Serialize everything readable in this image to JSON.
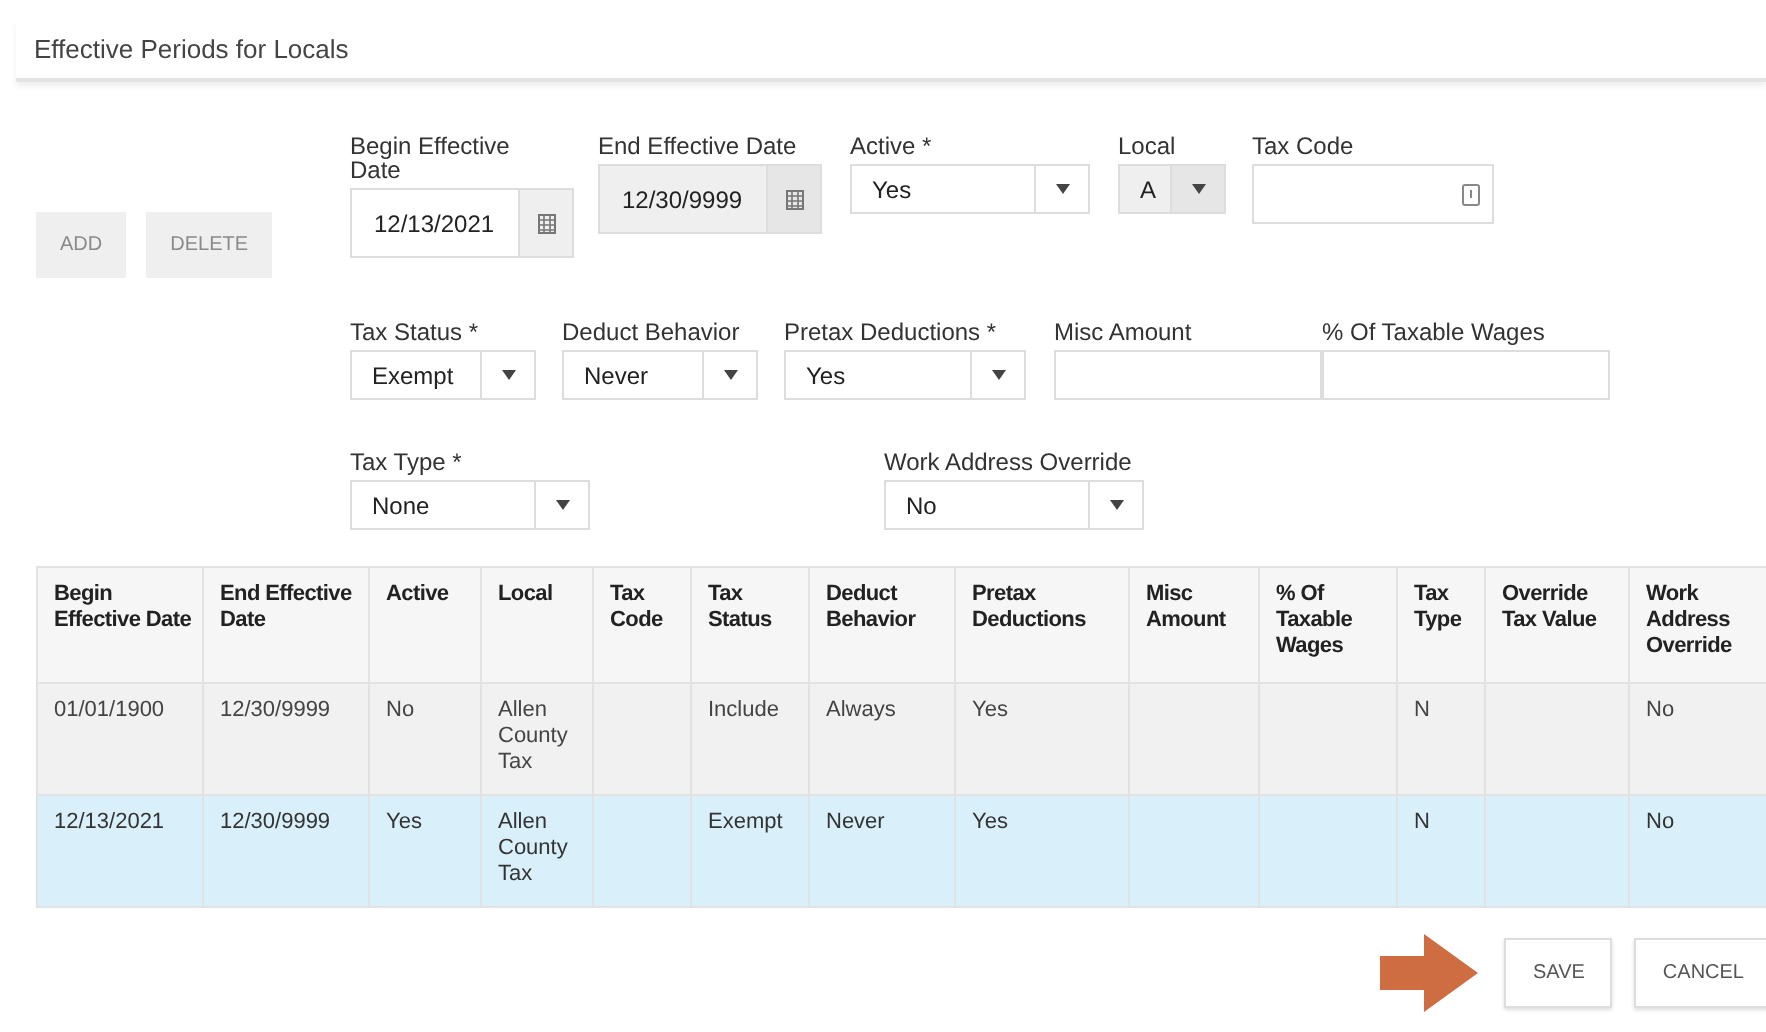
{
  "panel": {
    "title": "Effective Periods for Locals"
  },
  "toolbar": [
    {
      "label": "ADD",
      "disabled": true
    },
    {
      "label": "DELETE",
      "disabled": true
    }
  ],
  "form_rows": [
    [
      {
        "kind": "date",
        "label": "Begin Effective Date",
        "value": "12/13/2021",
        "disabled": false
      },
      {
        "kind": "date",
        "label": "End Effective Date",
        "value": "12/30/9999",
        "disabled": true
      },
      {
        "kind": "select",
        "label": "Active *",
        "value": "Yes",
        "disabled": false
      },
      {
        "kind": "select",
        "label": "Local",
        "value": "A",
        "disabled": true
      },
      {
        "kind": "lookup",
        "label": "Tax Code",
        "disabled": false
      }
    ],
    [
      {
        "kind": "select",
        "label": "Tax Status *",
        "value": "Exempt",
        "disabled": false
      },
      {
        "kind": "select",
        "label": "Deduct Behavior",
        "value": "Never",
        "disabled": false
      },
      {
        "kind": "select",
        "label": "Pretax Deductions *",
        "value": "Yes",
        "disabled": false
      },
      {
        "kind": "text",
        "label": "Misc Amount",
        "disabled": false
      },
      {
        "kind": "text",
        "label": "% Of Taxable Wages",
        "disabled": false
      }
    ],
    [
      {
        "kind": "select",
        "label": "Tax Type *",
        "value": "None",
        "disabled": false
      },
      {
        "kind": "select",
        "label": "Work Address Override",
        "value": "No",
        "disabled": false
      }
    ]
  ],
  "table": {
    "columns": [
      "Begin Effective Date",
      "End Effective Date",
      "Active",
      "Local",
      "Tax Code",
      "Tax Status",
      "Deduct Behavior",
      "Pretax Deductions",
      "Misc Amount",
      "% Of Taxable Wages",
      "Tax Type",
      "Override Tax Value",
      "Work Address Override"
    ],
    "rows": [
      {
        "selected": false,
        "cells": [
          "01/01/1900",
          "12/30/9999",
          "No",
          "Allen County Tax",
          "",
          "Include",
          "Always",
          "Yes",
          "",
          "",
          "N",
          "",
          "No"
        ]
      },
      {
        "selected": true,
        "cells": [
          "12/13/2021",
          "12/30/9999",
          "Yes",
          "Allen County Tax",
          "",
          "Exempt",
          "Never",
          "Yes",
          "",
          "",
          "N",
          "",
          "No"
        ]
      }
    ]
  },
  "actions": [
    {
      "label": "SAVE",
      "highlighted": true
    },
    {
      "label": "CANCEL",
      "highlighted": false
    }
  ]
}
